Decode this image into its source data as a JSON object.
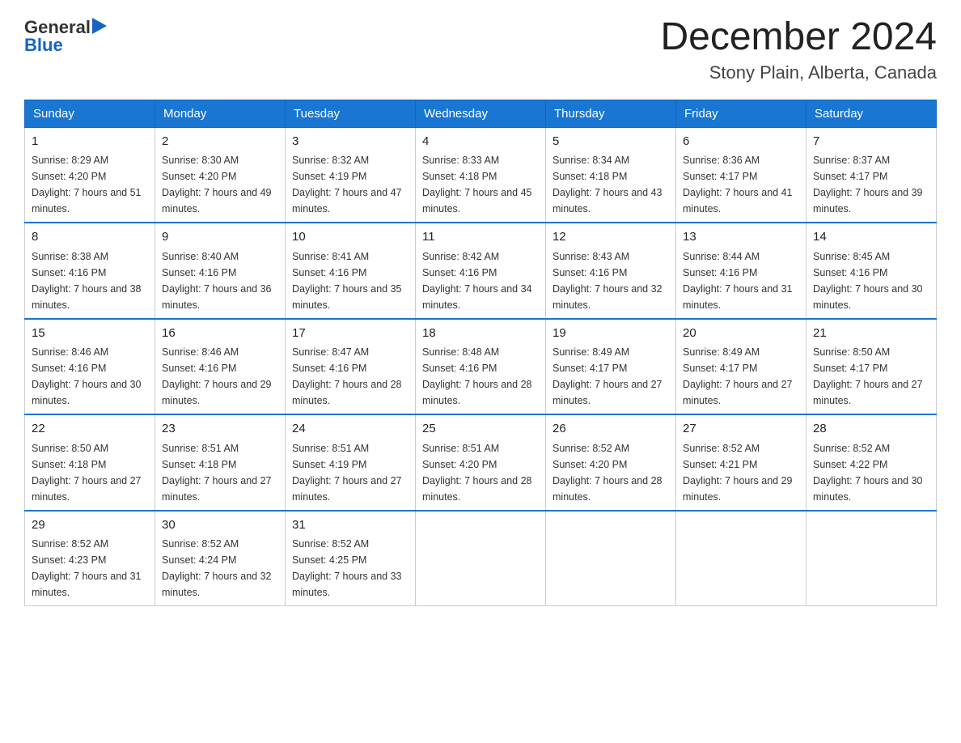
{
  "logo": {
    "text_general": "General",
    "text_blue": "Blue",
    "arrow": "▶"
  },
  "title": {
    "month": "December 2024",
    "location": "Stony Plain, Alberta, Canada"
  },
  "days_of_week": [
    "Sunday",
    "Monday",
    "Tuesday",
    "Wednesday",
    "Thursday",
    "Friday",
    "Saturday"
  ],
  "weeks": [
    [
      {
        "day": "1",
        "sunrise": "8:29 AM",
        "sunset": "4:20 PM",
        "daylight": "7 hours and 51 minutes."
      },
      {
        "day": "2",
        "sunrise": "8:30 AM",
        "sunset": "4:20 PM",
        "daylight": "7 hours and 49 minutes."
      },
      {
        "day": "3",
        "sunrise": "8:32 AM",
        "sunset": "4:19 PM",
        "daylight": "7 hours and 47 minutes."
      },
      {
        "day": "4",
        "sunrise": "8:33 AM",
        "sunset": "4:18 PM",
        "daylight": "7 hours and 45 minutes."
      },
      {
        "day": "5",
        "sunrise": "8:34 AM",
        "sunset": "4:18 PM",
        "daylight": "7 hours and 43 minutes."
      },
      {
        "day": "6",
        "sunrise": "8:36 AM",
        "sunset": "4:17 PM",
        "daylight": "7 hours and 41 minutes."
      },
      {
        "day": "7",
        "sunrise": "8:37 AM",
        "sunset": "4:17 PM",
        "daylight": "7 hours and 39 minutes."
      }
    ],
    [
      {
        "day": "8",
        "sunrise": "8:38 AM",
        "sunset": "4:16 PM",
        "daylight": "7 hours and 38 minutes."
      },
      {
        "day": "9",
        "sunrise": "8:40 AM",
        "sunset": "4:16 PM",
        "daylight": "7 hours and 36 minutes."
      },
      {
        "day": "10",
        "sunrise": "8:41 AM",
        "sunset": "4:16 PM",
        "daylight": "7 hours and 35 minutes."
      },
      {
        "day": "11",
        "sunrise": "8:42 AM",
        "sunset": "4:16 PM",
        "daylight": "7 hours and 34 minutes."
      },
      {
        "day": "12",
        "sunrise": "8:43 AM",
        "sunset": "4:16 PM",
        "daylight": "7 hours and 32 minutes."
      },
      {
        "day": "13",
        "sunrise": "8:44 AM",
        "sunset": "4:16 PM",
        "daylight": "7 hours and 31 minutes."
      },
      {
        "day": "14",
        "sunrise": "8:45 AM",
        "sunset": "4:16 PM",
        "daylight": "7 hours and 30 minutes."
      }
    ],
    [
      {
        "day": "15",
        "sunrise": "8:46 AM",
        "sunset": "4:16 PM",
        "daylight": "7 hours and 30 minutes."
      },
      {
        "day": "16",
        "sunrise": "8:46 AM",
        "sunset": "4:16 PM",
        "daylight": "7 hours and 29 minutes."
      },
      {
        "day": "17",
        "sunrise": "8:47 AM",
        "sunset": "4:16 PM",
        "daylight": "7 hours and 28 minutes."
      },
      {
        "day": "18",
        "sunrise": "8:48 AM",
        "sunset": "4:16 PM",
        "daylight": "7 hours and 28 minutes."
      },
      {
        "day": "19",
        "sunrise": "8:49 AM",
        "sunset": "4:17 PM",
        "daylight": "7 hours and 27 minutes."
      },
      {
        "day": "20",
        "sunrise": "8:49 AM",
        "sunset": "4:17 PM",
        "daylight": "7 hours and 27 minutes."
      },
      {
        "day": "21",
        "sunrise": "8:50 AM",
        "sunset": "4:17 PM",
        "daylight": "7 hours and 27 minutes."
      }
    ],
    [
      {
        "day": "22",
        "sunrise": "8:50 AM",
        "sunset": "4:18 PM",
        "daylight": "7 hours and 27 minutes."
      },
      {
        "day": "23",
        "sunrise": "8:51 AM",
        "sunset": "4:18 PM",
        "daylight": "7 hours and 27 minutes."
      },
      {
        "day": "24",
        "sunrise": "8:51 AM",
        "sunset": "4:19 PM",
        "daylight": "7 hours and 27 minutes."
      },
      {
        "day": "25",
        "sunrise": "8:51 AM",
        "sunset": "4:20 PM",
        "daylight": "7 hours and 28 minutes."
      },
      {
        "day": "26",
        "sunrise": "8:52 AM",
        "sunset": "4:20 PM",
        "daylight": "7 hours and 28 minutes."
      },
      {
        "day": "27",
        "sunrise": "8:52 AM",
        "sunset": "4:21 PM",
        "daylight": "7 hours and 29 minutes."
      },
      {
        "day": "28",
        "sunrise": "8:52 AM",
        "sunset": "4:22 PM",
        "daylight": "7 hours and 30 minutes."
      }
    ],
    [
      {
        "day": "29",
        "sunrise": "8:52 AM",
        "sunset": "4:23 PM",
        "daylight": "7 hours and 31 minutes."
      },
      {
        "day": "30",
        "sunrise": "8:52 AM",
        "sunset": "4:24 PM",
        "daylight": "7 hours and 32 minutes."
      },
      {
        "day": "31",
        "sunrise": "8:52 AM",
        "sunset": "4:25 PM",
        "daylight": "7 hours and 33 minutes."
      },
      null,
      null,
      null,
      null
    ]
  ]
}
